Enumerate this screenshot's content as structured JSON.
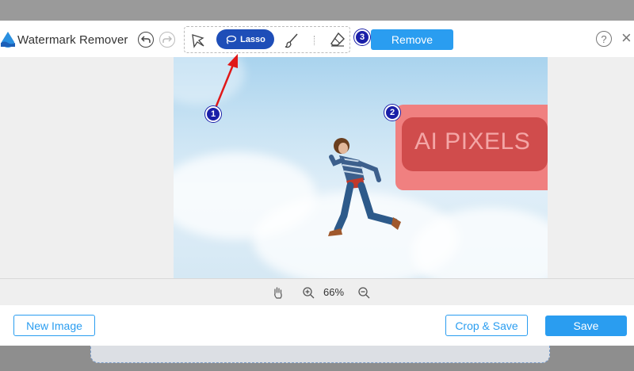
{
  "app": {
    "title": "Watermark Remover"
  },
  "toolbar": {
    "lasso_label": "Lasso",
    "remove_label": "Remove",
    "help_symbol": "?",
    "close_symbol": "×"
  },
  "steps": {
    "one": "1",
    "two": "2",
    "three": "3"
  },
  "watermark": {
    "text": "AI PIXELS"
  },
  "zoom": {
    "level": "66%"
  },
  "footer": {
    "new_image_label": "New Image",
    "crop_save_label": "Crop & Save",
    "save_label": "Save"
  },
  "colors": {
    "accent": "#2a9df0",
    "lasso_active": "#1e4eb8",
    "badge": "#1a1fa8",
    "mask": "#f08080",
    "watermark_box": "#d04c4c",
    "annotation_arrow": "#e01818"
  },
  "icons": {
    "logo": "water-drop-icon",
    "undo": "undo-icon",
    "redo": "redo-icon",
    "polygon": "polygon-lasso-icon",
    "lasso": "lasso-icon",
    "brush": "brush-icon",
    "eraser": "eraser-icon",
    "help": "help-icon",
    "close": "close-icon",
    "hand": "hand-pan-icon",
    "zoom_in": "zoom-in-icon",
    "zoom_out": "zoom-out-icon"
  }
}
